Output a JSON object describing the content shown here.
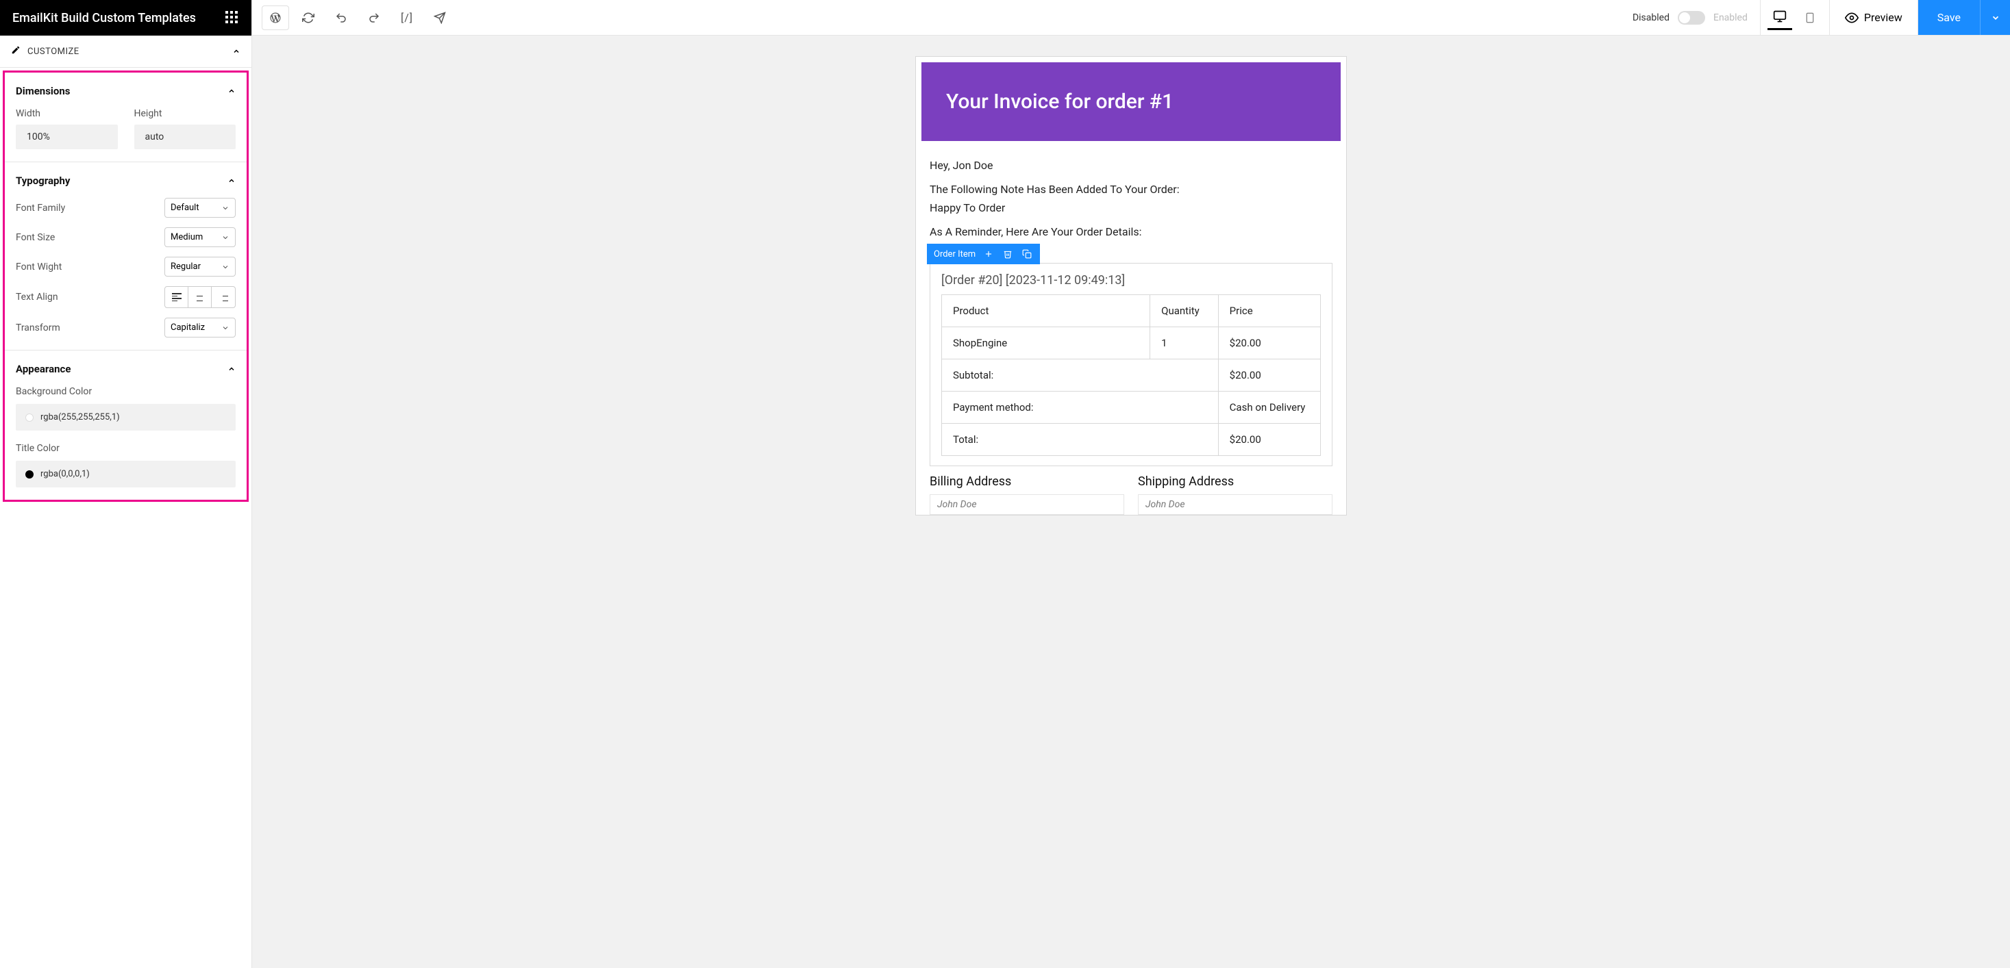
{
  "sidebar": {
    "app_title": "EmailKit Build Custom Templates",
    "customize_label": "CUSTOMIZE",
    "sections": {
      "dimensions": {
        "title": "Dimensions",
        "width_label": "Width",
        "width_value": "100%",
        "height_label": "Height",
        "height_value": "auto"
      },
      "typography": {
        "title": "Typography",
        "font_family_label": "Font Family",
        "font_family_value": "Default",
        "font_size_label": "Font Size",
        "font_size_value": "Medium",
        "font_weight_label": "Font Wight",
        "font_weight_value": "Regular",
        "text_align_label": "Text Align",
        "transform_label": "Transform",
        "transform_value": "Capitaliz"
      },
      "appearance": {
        "title": "Appearance",
        "bg_color_label": "Background Color",
        "bg_color_value": "rgba(255,255,255,1)",
        "bg_color_hex": "#ffffff",
        "title_color_label": "Title Color",
        "title_color_value": "rgba(0,0,0,1)",
        "title_color_hex": "#000000"
      }
    }
  },
  "topbar": {
    "disabled_label": "Disabled",
    "enabled_label": "Enabled",
    "preview_label": "Preview",
    "save_label": "Save"
  },
  "email": {
    "invoice_title": "Your Invoice for order #1",
    "greeting": "Hey, Jon Doe",
    "note_line": "The Following Note Has Been Added To Your Order:",
    "note_body": "Happy To Order",
    "reminder": "As A Reminder, Here Are Your Order Details:",
    "block_toolbar_label": "Order Item",
    "order_meta": "[Order #20] [2023-11-12 09:49:13]",
    "headers": {
      "product": "Product",
      "quantity": "Quantity",
      "price": "Price"
    },
    "items": [
      {
        "product": "ShopEngine",
        "qty": "1",
        "price": "$20.00"
      }
    ],
    "summary": [
      {
        "label": "Subtotal:",
        "value": "$20.00",
        "bold": true
      },
      {
        "label": "Payment method:",
        "value": "Cash on Delivery",
        "bold": false
      },
      {
        "label": "Total:",
        "value": "$20.00",
        "bold": false
      }
    ],
    "billing_title": "Billing Address",
    "shipping_title": "Shipping Address",
    "billing_name": "John Doe",
    "shipping_name": "John Doe"
  }
}
